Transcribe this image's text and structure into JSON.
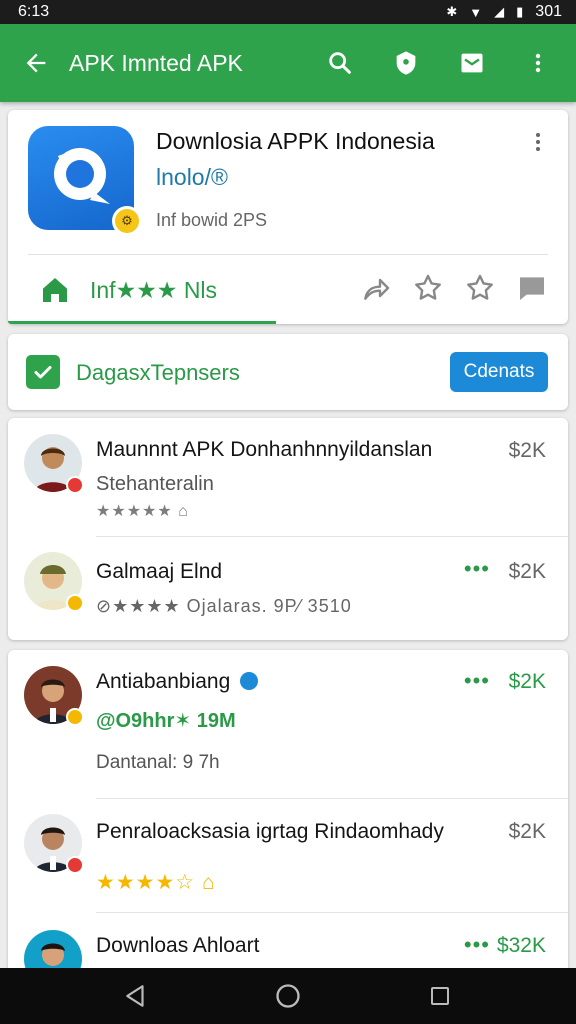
{
  "status_bar": {
    "time": "6:13",
    "battery": "301"
  },
  "app_bar": {
    "title": "APK Imnted APK"
  },
  "app_card": {
    "title": "Downlosia APPK Indonesia",
    "subtitle": "lnolo/®",
    "meta": "Inf bowid 2PS",
    "rating_text": "Inf★★★ Nls"
  },
  "filter": {
    "label": "DagasxTepnsers",
    "button": "Cdenats",
    "checked": true
  },
  "list_top": [
    {
      "title": "Maunnnt APK Donhanhnnyildanslan",
      "subtitle": "Stehanteralin",
      "stars": "★★★★★ ⌂",
      "price": "$2K",
      "dot_color": "#e53935"
    },
    {
      "title": "Galmaaj Elnd",
      "stars": "⊘★★★★  Ojalaras. 9P⁄ 3510",
      "price": "$2K",
      "dot_color": "#f5b800"
    }
  ],
  "list_bottom": [
    {
      "title": "Antiabanbiang",
      "subtitle": "@O9hhr✶ 19M",
      "extra": "Dantanal: 9 7h",
      "price": "$2K",
      "dot_color": "#f5b800"
    },
    {
      "title": "Penraloacksasia igrtag Rindaomhady",
      "stars": "★★★★☆ ⌂",
      "price": "$2K",
      "dot_color": "#e53935"
    },
    {
      "title": "Downloas Ahloart",
      "price": "$32K"
    }
  ],
  "colors": {
    "primary": "#2fa34c",
    "accent": "#1d8ad8",
    "star": "#f5b800"
  }
}
